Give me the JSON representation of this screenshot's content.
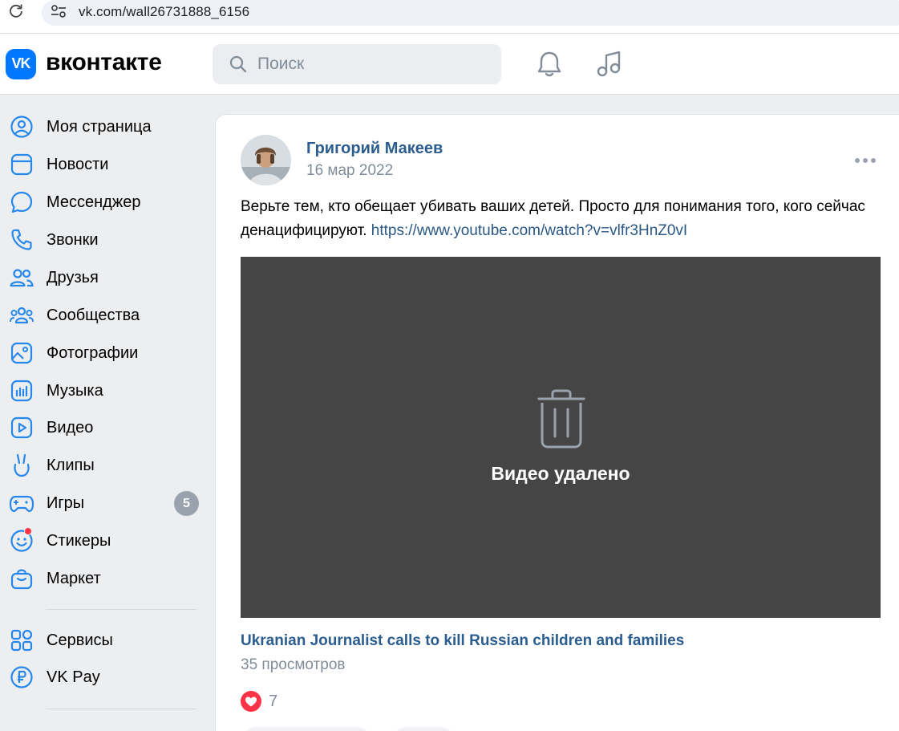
{
  "browser": {
    "url": "vk.com/wall26731888_6156"
  },
  "header": {
    "logo_text": "VK",
    "brand": "вконтакте",
    "search_placeholder": "Поиск"
  },
  "sidebar": {
    "items": [
      {
        "label": "Моя страница",
        "icon": "user-circle-icon"
      },
      {
        "label": "Новости",
        "icon": "newsfeed-icon"
      },
      {
        "label": "Мессенджер",
        "icon": "message-icon"
      },
      {
        "label": "Звонки",
        "icon": "phone-icon"
      },
      {
        "label": "Друзья",
        "icon": "friends-icon"
      },
      {
        "label": "Сообщества",
        "icon": "communities-icon"
      },
      {
        "label": "Фотографии",
        "icon": "photos-icon"
      },
      {
        "label": "Музыка",
        "icon": "music-icon"
      },
      {
        "label": "Видео",
        "icon": "video-icon"
      },
      {
        "label": "Клипы",
        "icon": "clips-icon"
      },
      {
        "label": "Игры",
        "icon": "gamepad-icon",
        "badge": "5"
      },
      {
        "label": "Стикеры",
        "icon": "sticker-icon"
      },
      {
        "label": "Маркет",
        "icon": "market-icon"
      },
      {
        "label": "Сервисы",
        "icon": "services-icon"
      },
      {
        "label": "VK Pay",
        "icon": "vkpay-icon"
      }
    ]
  },
  "post": {
    "author": "Григорий Макеев",
    "date": "16 мар 2022",
    "text": "Верьте тем, кто обещает убивать ваших детей. Просто для понимания того, кого сейчас денацифицируют. ",
    "link": "https://www.youtube.com/watch?v=vlfr3HnZ0vI",
    "video_status": "Видео удалено",
    "video_title": "Ukranian Journalist calls to kill Russian children and families",
    "views": "35 просмотров",
    "likes": "7"
  },
  "colors": {
    "accent": "#0077ff",
    "link": "#2c5d8f",
    "secondary_text": "#818c99",
    "like": "#ff3347",
    "video_bg": "#454545"
  }
}
